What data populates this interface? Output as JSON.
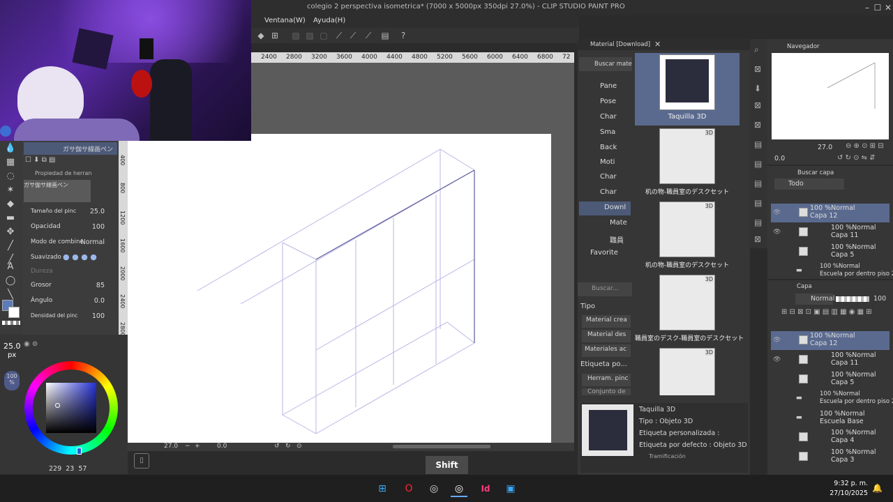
{
  "window": {
    "title": "colegio 2 perspectiva isometrica* (7000 x 5000px 350dpi 27.0%) - CLIP STUDIO PAINT PRO"
  },
  "menu": [
    "Ventana(W)",
    "Ayuda(H)"
  ],
  "ruler": {
    "labels": [
      "2400",
      "2800",
      "3200",
      "3600",
      "4000",
      "4400",
      "4800",
      "5200",
      "5600",
      "6000",
      "6400",
      "6800",
      "72"
    ],
    "vertical": [
      "400",
      "800",
      "1200",
      "1600",
      "2000",
      "2400",
      "2800",
      "3200",
      "3600",
      "4000",
      "4400"
    ]
  },
  "canvas_status": {
    "zoom": "27.0",
    "angle": "0.0"
  },
  "subtool": {
    "brush_name": "ガサ伽サ線画ペン",
    "tool_property_title": "Propiedad de herran",
    "preview_name": "ガサ伽サ線画ペン",
    "properties": [
      {
        "label": "Tamaño del pinc",
        "value": "25.0"
      },
      {
        "label": "Opacidad",
        "value": "100"
      },
      {
        "label": "Modo de combine",
        "value": "Normal"
      },
      {
        "label": "Suavizado",
        "value": ""
      },
      {
        "label": "Dureza",
        "value": ""
      },
      {
        "label": "Grosor",
        "value": "85"
      },
      {
        "label": "Ángulo",
        "value": "0.0"
      },
      {
        "label": "Densidad del pinc",
        "value": "100"
      }
    ]
  },
  "brush_size": {
    "value": "25.0",
    "unit": "px"
  },
  "opacity_badge": {
    "value": "100",
    "unit": "%"
  },
  "color_readout": {
    "r": "229",
    "g": "23",
    "b": "57"
  },
  "material": {
    "panel_title": "Material [Download]",
    "search_label": "Buscar materi",
    "tree": [
      "Pane",
      "Pose",
      "Char",
      "Sma",
      "Back",
      "Moti",
      "Char",
      "Char",
      "Downl",
      "Mate",
      "職員",
      "Favorite"
    ],
    "search2": "Buscar...",
    "tipo_label": "Tipo",
    "tipo_items": [
      "Material crea",
      "Material des",
      "Materiales ac"
    ],
    "etiqueta_label": "Etiqueta po...",
    "etiqueta_items": [
      "Herram. pinc",
      "Conjunto de"
    ],
    "items": [
      {
        "label": "Taquilla 3D",
        "badge": ""
      },
      {
        "label": "机の物-職員室のデスクセット",
        "badge": "3D"
      },
      {
        "label": "机の物-職員室のデスクセット",
        "badge": "3D"
      },
      {
        "label": "職員室のデスク-職員室のデスクセット",
        "badge": "3D"
      },
      {
        "label": "",
        "badge": "3D"
      }
    ],
    "detail": {
      "name": "Taquilla 3D",
      "tipo": "Tipo : Objeto 3D",
      "etiqueta_custom": "Etiqueta personalizada :",
      "etiqueta_default": "Etiqueta por defecto : Objeto 3D",
      "tramificacion": "Tramificación"
    }
  },
  "navigator": {
    "title": "Navegador",
    "zoom": "27.0",
    "angle": "0.0"
  },
  "layer_search": {
    "title": "Buscar capa",
    "filter": "Todo"
  },
  "layers_top": [
    {
      "mode": "100 %Normal",
      "name": "Capa 12",
      "selected": true
    },
    {
      "mode": "100 %Normal",
      "name": "Capa 11",
      "selected": false
    },
    {
      "mode": "100 %Normal",
      "name": "Capa 5",
      "selected": false
    },
    {
      "mode": "100 %Normal",
      "name": "Escuela por dentro piso 2",
      "selected": false
    }
  ],
  "layer_panel": {
    "title": "Capa",
    "blend": "Normal",
    "opacity": "100"
  },
  "layers": [
    {
      "mode": "100 %Normal",
      "name": "Capa 12",
      "selected": true
    },
    {
      "mode": "100 %Normal",
      "name": "Capa 11",
      "selected": false
    },
    {
      "mode": "100 %Normal",
      "name": "Capa 5",
      "selected": false
    },
    {
      "mode": "100 %Normal",
      "name": "Escuela por dentro piso 2",
      "selected": false
    },
    {
      "mode": "100 %Normal",
      "name": "Escuela Base",
      "selected": false
    },
    {
      "mode": "100 %Normal",
      "name": "Capa 4",
      "selected": false
    },
    {
      "mode": "100 %Normal",
      "name": "Capa 3",
      "selected": false
    }
  ],
  "shift_badge": "Shift",
  "taskbar": {
    "time": "9:32 p. m.",
    "date": "27/10/2025"
  }
}
